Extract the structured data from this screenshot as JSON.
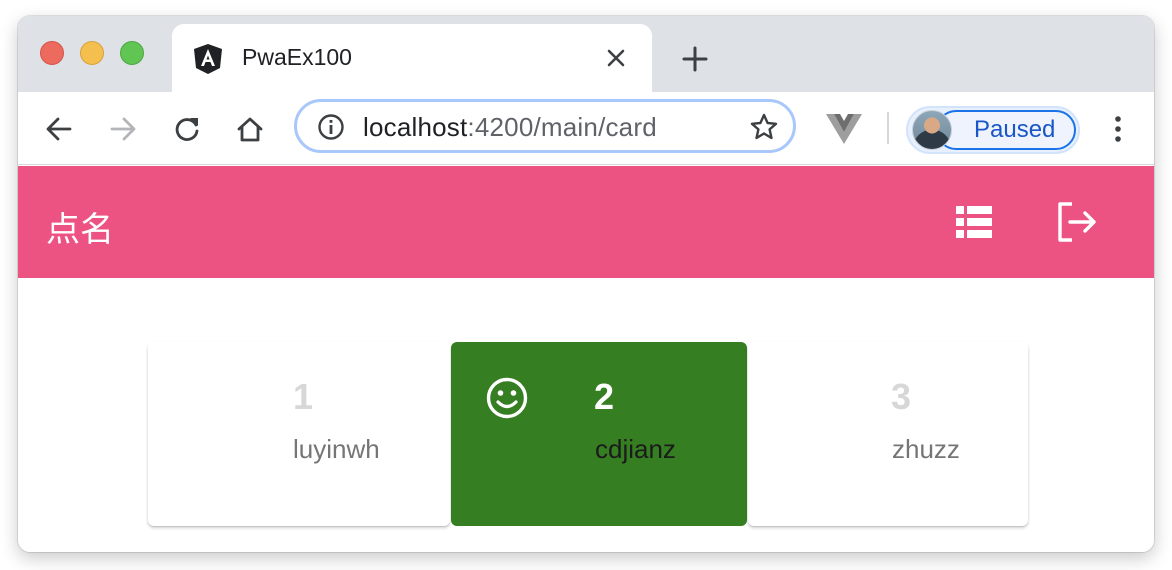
{
  "browser": {
    "tab": {
      "title": "PwaEx100",
      "favicon": "angular-icon"
    },
    "url": {
      "host": "localhost",
      "rest": ":4200/main/card"
    },
    "profile": {
      "label": "Paused"
    },
    "colors": {
      "omnibox_border": "#a8c7fa",
      "profile_accent": "#1a73e8"
    }
  },
  "app": {
    "title": "点名",
    "header_color": "#ec5382",
    "actions": [
      {
        "name": "list-view",
        "icon": "view-list-icon"
      },
      {
        "name": "logout",
        "icon": "exit-to-app-icon"
      }
    ]
  },
  "cards": [
    {
      "number": "1",
      "name": "luyinwh",
      "selected": false
    },
    {
      "number": "2",
      "name": "cdjianz",
      "selected": true,
      "icon": "smiley-face-icon",
      "color": "#367e22"
    },
    {
      "number": "3",
      "name": "zhuzz",
      "selected": false
    }
  ]
}
